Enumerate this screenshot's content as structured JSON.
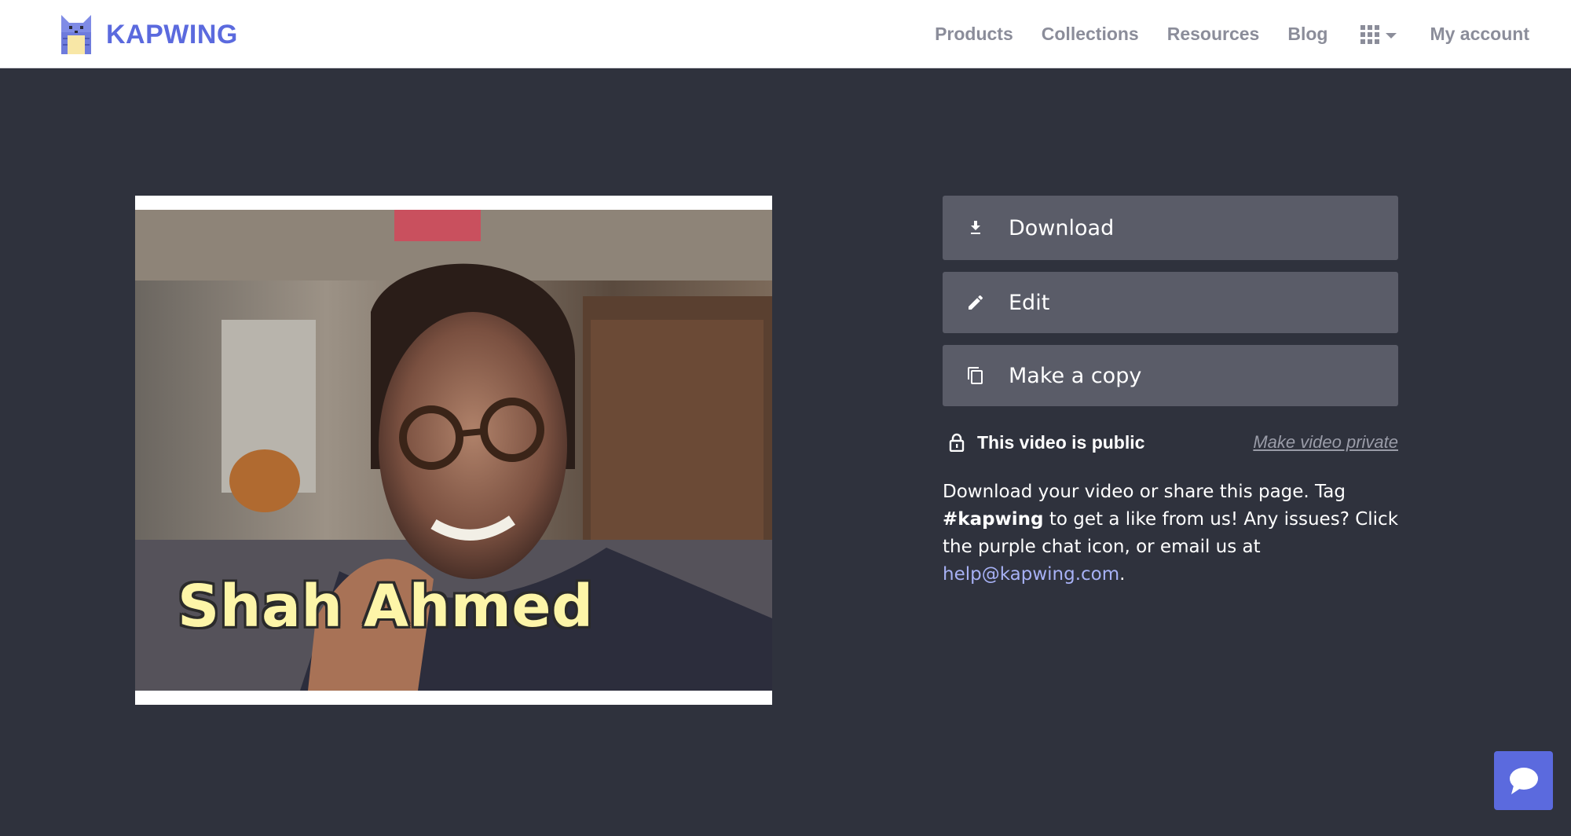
{
  "header": {
    "brand": "KAPWING",
    "nav": {
      "products": "Products",
      "collections": "Collections",
      "resources": "Resources",
      "blog": "Blog",
      "account": "My account"
    },
    "apps_icon": "apps-grid-icon"
  },
  "video": {
    "caption": "Shah Ahmed"
  },
  "actions": {
    "download": "Download",
    "edit": "Edit",
    "copy": "Make a copy"
  },
  "privacy": {
    "status": "This video is public",
    "toggle": "Make video private"
  },
  "info": {
    "text_1": "Download your video or share this page. Tag ",
    "hashtag": "#kapwing",
    "text_2": " to get a like from us! Any issues? Click the purple chat icon, or email us at ",
    "email": "help@kapwing.com",
    "text_3": "."
  },
  "colors": {
    "brand": "#5b6ade",
    "background": "#2f323d",
    "button": "#5a5c68",
    "link": "#a7b1f5"
  }
}
